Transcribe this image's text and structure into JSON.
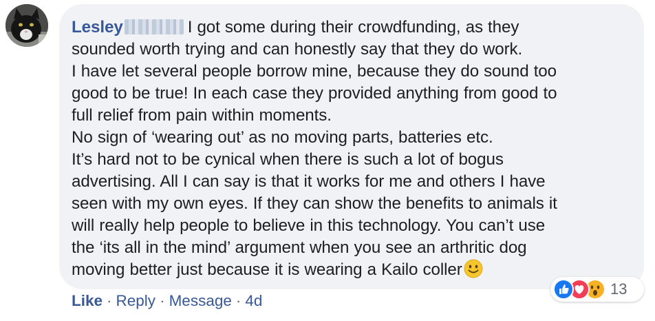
{
  "comment": {
    "author_first_name": "Lesley",
    "lines": [
      "I got some during their crowdfunding, as they",
      "sounded worth trying and can honestly say that they do work.",
      "I have let several people borrow mine, because they do sound too",
      "good to be true! In each case they provided anything from good to",
      "full relief from pain within moments.",
      "No sign of ‘wearing out’ as no moving parts, batteries etc.",
      "It’s hard not to be cynical when there is such a lot of bogus",
      "advertising. All I can say is that it works for me and others I have",
      "seen with my own eyes. If they can show the benefits to animals it",
      "will really help people to believe in this technology. You can’t use",
      "the ‘its all in the mind’ argument when you see an arthritic dog",
      "moving better just because it is wearing a Kailo coller"
    ],
    "trailing_emoji": "slightly-smiling-face-icon"
  },
  "reactions": {
    "icons": [
      "like-reaction-icon",
      "love-reaction-icon",
      "wow-reaction-icon"
    ],
    "count": "13"
  },
  "actions": {
    "like": "Like",
    "reply": "Reply",
    "message": "Message",
    "timestamp": "4d",
    "separator": "·"
  },
  "colors": {
    "link_blue": "#385898",
    "bubble_bg": "#f0f2f5",
    "meta_gray": "#606770",
    "like_blue": "#1877f2",
    "love_red": "#f33e58",
    "wow_yellow": "#f7b125"
  }
}
